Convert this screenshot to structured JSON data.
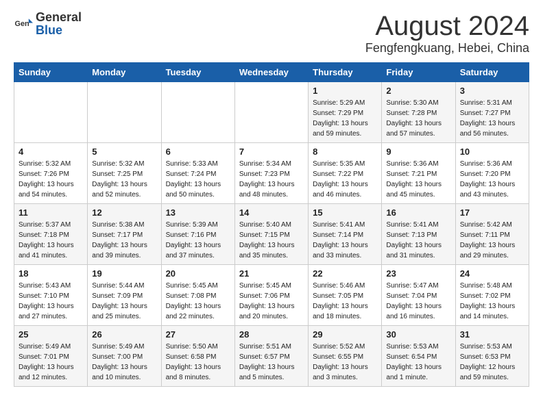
{
  "logo": {
    "general": "General",
    "blue": "Blue"
  },
  "header": {
    "month": "August 2024",
    "location": "Fengfengkuang, Hebei, China"
  },
  "weekdays": [
    "Sunday",
    "Monday",
    "Tuesday",
    "Wednesday",
    "Thursday",
    "Friday",
    "Saturday"
  ],
  "weeks": [
    [
      {
        "day": "",
        "info": ""
      },
      {
        "day": "",
        "info": ""
      },
      {
        "day": "",
        "info": ""
      },
      {
        "day": "",
        "info": ""
      },
      {
        "day": "1",
        "info": "Sunrise: 5:29 AM\nSunset: 7:29 PM\nDaylight: 13 hours\nand 59 minutes."
      },
      {
        "day": "2",
        "info": "Sunrise: 5:30 AM\nSunset: 7:28 PM\nDaylight: 13 hours\nand 57 minutes."
      },
      {
        "day": "3",
        "info": "Sunrise: 5:31 AM\nSunset: 7:27 PM\nDaylight: 13 hours\nand 56 minutes."
      }
    ],
    [
      {
        "day": "4",
        "info": "Sunrise: 5:32 AM\nSunset: 7:26 PM\nDaylight: 13 hours\nand 54 minutes."
      },
      {
        "day": "5",
        "info": "Sunrise: 5:32 AM\nSunset: 7:25 PM\nDaylight: 13 hours\nand 52 minutes."
      },
      {
        "day": "6",
        "info": "Sunrise: 5:33 AM\nSunset: 7:24 PM\nDaylight: 13 hours\nand 50 minutes."
      },
      {
        "day": "7",
        "info": "Sunrise: 5:34 AM\nSunset: 7:23 PM\nDaylight: 13 hours\nand 48 minutes."
      },
      {
        "day": "8",
        "info": "Sunrise: 5:35 AM\nSunset: 7:22 PM\nDaylight: 13 hours\nand 46 minutes."
      },
      {
        "day": "9",
        "info": "Sunrise: 5:36 AM\nSunset: 7:21 PM\nDaylight: 13 hours\nand 45 minutes."
      },
      {
        "day": "10",
        "info": "Sunrise: 5:36 AM\nSunset: 7:20 PM\nDaylight: 13 hours\nand 43 minutes."
      }
    ],
    [
      {
        "day": "11",
        "info": "Sunrise: 5:37 AM\nSunset: 7:18 PM\nDaylight: 13 hours\nand 41 minutes."
      },
      {
        "day": "12",
        "info": "Sunrise: 5:38 AM\nSunset: 7:17 PM\nDaylight: 13 hours\nand 39 minutes."
      },
      {
        "day": "13",
        "info": "Sunrise: 5:39 AM\nSunset: 7:16 PM\nDaylight: 13 hours\nand 37 minutes."
      },
      {
        "day": "14",
        "info": "Sunrise: 5:40 AM\nSunset: 7:15 PM\nDaylight: 13 hours\nand 35 minutes."
      },
      {
        "day": "15",
        "info": "Sunrise: 5:41 AM\nSunset: 7:14 PM\nDaylight: 13 hours\nand 33 minutes."
      },
      {
        "day": "16",
        "info": "Sunrise: 5:41 AM\nSunset: 7:13 PM\nDaylight: 13 hours\nand 31 minutes."
      },
      {
        "day": "17",
        "info": "Sunrise: 5:42 AM\nSunset: 7:11 PM\nDaylight: 13 hours\nand 29 minutes."
      }
    ],
    [
      {
        "day": "18",
        "info": "Sunrise: 5:43 AM\nSunset: 7:10 PM\nDaylight: 13 hours\nand 27 minutes."
      },
      {
        "day": "19",
        "info": "Sunrise: 5:44 AM\nSunset: 7:09 PM\nDaylight: 13 hours\nand 25 minutes."
      },
      {
        "day": "20",
        "info": "Sunrise: 5:45 AM\nSunset: 7:08 PM\nDaylight: 13 hours\nand 22 minutes."
      },
      {
        "day": "21",
        "info": "Sunrise: 5:45 AM\nSunset: 7:06 PM\nDaylight: 13 hours\nand 20 minutes."
      },
      {
        "day": "22",
        "info": "Sunrise: 5:46 AM\nSunset: 7:05 PM\nDaylight: 13 hours\nand 18 minutes."
      },
      {
        "day": "23",
        "info": "Sunrise: 5:47 AM\nSunset: 7:04 PM\nDaylight: 13 hours\nand 16 minutes."
      },
      {
        "day": "24",
        "info": "Sunrise: 5:48 AM\nSunset: 7:02 PM\nDaylight: 13 hours\nand 14 minutes."
      }
    ],
    [
      {
        "day": "25",
        "info": "Sunrise: 5:49 AM\nSunset: 7:01 PM\nDaylight: 13 hours\nand 12 minutes."
      },
      {
        "day": "26",
        "info": "Sunrise: 5:49 AM\nSunset: 7:00 PM\nDaylight: 13 hours\nand 10 minutes."
      },
      {
        "day": "27",
        "info": "Sunrise: 5:50 AM\nSunset: 6:58 PM\nDaylight: 13 hours\nand 8 minutes."
      },
      {
        "day": "28",
        "info": "Sunrise: 5:51 AM\nSunset: 6:57 PM\nDaylight: 13 hours\nand 5 minutes."
      },
      {
        "day": "29",
        "info": "Sunrise: 5:52 AM\nSunset: 6:55 PM\nDaylight: 13 hours\nand 3 minutes."
      },
      {
        "day": "30",
        "info": "Sunrise: 5:53 AM\nSunset: 6:54 PM\nDaylight: 13 hours\nand 1 minute."
      },
      {
        "day": "31",
        "info": "Sunrise: 5:53 AM\nSunset: 6:53 PM\nDaylight: 12 hours\nand 59 minutes."
      }
    ]
  ]
}
